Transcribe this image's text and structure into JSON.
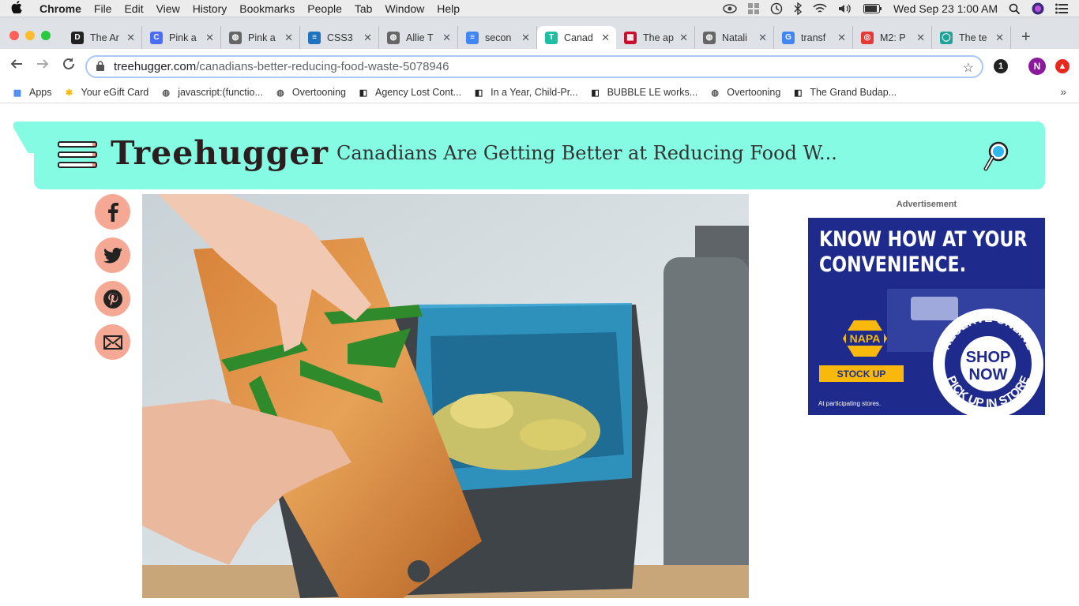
{
  "menubar": {
    "app": "Chrome",
    "items": [
      "File",
      "Edit",
      "View",
      "History",
      "Bookmarks",
      "People",
      "Tab",
      "Window",
      "Help"
    ],
    "clock": "Wed Sep 23  1:00 AM"
  },
  "tabs": [
    {
      "title": "The Ar",
      "color": "#222",
      "glyph": "D"
    },
    {
      "title": "Pink a",
      "color": "#4a6cf7",
      "glyph": "C"
    },
    {
      "title": "Pink a",
      "color": "#666",
      "glyph": "◍"
    },
    {
      "title": "CSS3",
      "color": "#1e73be",
      "glyph": "≡"
    },
    {
      "title": "Allie T",
      "color": "#666",
      "glyph": "◍"
    },
    {
      "title": "secon",
      "color": "#4285f4",
      "glyph": "≡"
    },
    {
      "title": "Canad",
      "color": "#1fbfa4",
      "glyph": "T",
      "active": true
    },
    {
      "title": "The ap",
      "color": "#c8102e",
      "glyph": "▦"
    },
    {
      "title": "Natali",
      "color": "#666",
      "glyph": "◍"
    },
    {
      "title": "transf",
      "color": "#4285f4",
      "glyph": "G"
    },
    {
      "title": "M2: P",
      "color": "#e53935",
      "glyph": "◎"
    },
    {
      "title": "The te",
      "color": "#1fa39a",
      "glyph": "◯"
    }
  ],
  "omnibox": {
    "host": "treehugger.com",
    "path": "/canadians-better-reducing-food-waste-5078946"
  },
  "profile_initial": "N",
  "ext_badge": "1",
  "bookmarks": [
    {
      "label": "Apps",
      "icon": "apps-icon"
    },
    {
      "label": "Your eGift Card",
      "icon": "walmart-icon"
    },
    {
      "label": "javascript:(functio...",
      "icon": "globe-icon"
    },
    {
      "label": "Overtooning",
      "icon": "globe-icon"
    },
    {
      "label": "Agency Lost Cont...",
      "icon": "bookmark-icon"
    },
    {
      "label": "In a Year, Child-Pr...",
      "icon": "bookmark-icon"
    },
    {
      "label": "BUBBLE LE works...",
      "icon": "bookmark-icon"
    },
    {
      "label": "Overtooning",
      "icon": "globe-icon"
    },
    {
      "label": "The Grand Budap...",
      "icon": "bookmark-icon"
    }
  ],
  "site": {
    "logo": "Treehugger",
    "headline": "Canadians Are Getting Better at Reducing Food W...",
    "accent": "#86fbe4",
    "social_color": "#f5a995"
  },
  "ad": {
    "label": "Advertisement",
    "headline_line1": "KNOW HOW AT YOUR",
    "headline_line2": "CONVENIENCE.",
    "brand": "NAPA",
    "cta": "STOCK UP",
    "badge_top": "RESERVE ONLINE",
    "badge_center1": "SHOP",
    "badge_center2": "NOW",
    "badge_bottom": "PICK UP IN STORE",
    "footnote": "At participating stores."
  }
}
